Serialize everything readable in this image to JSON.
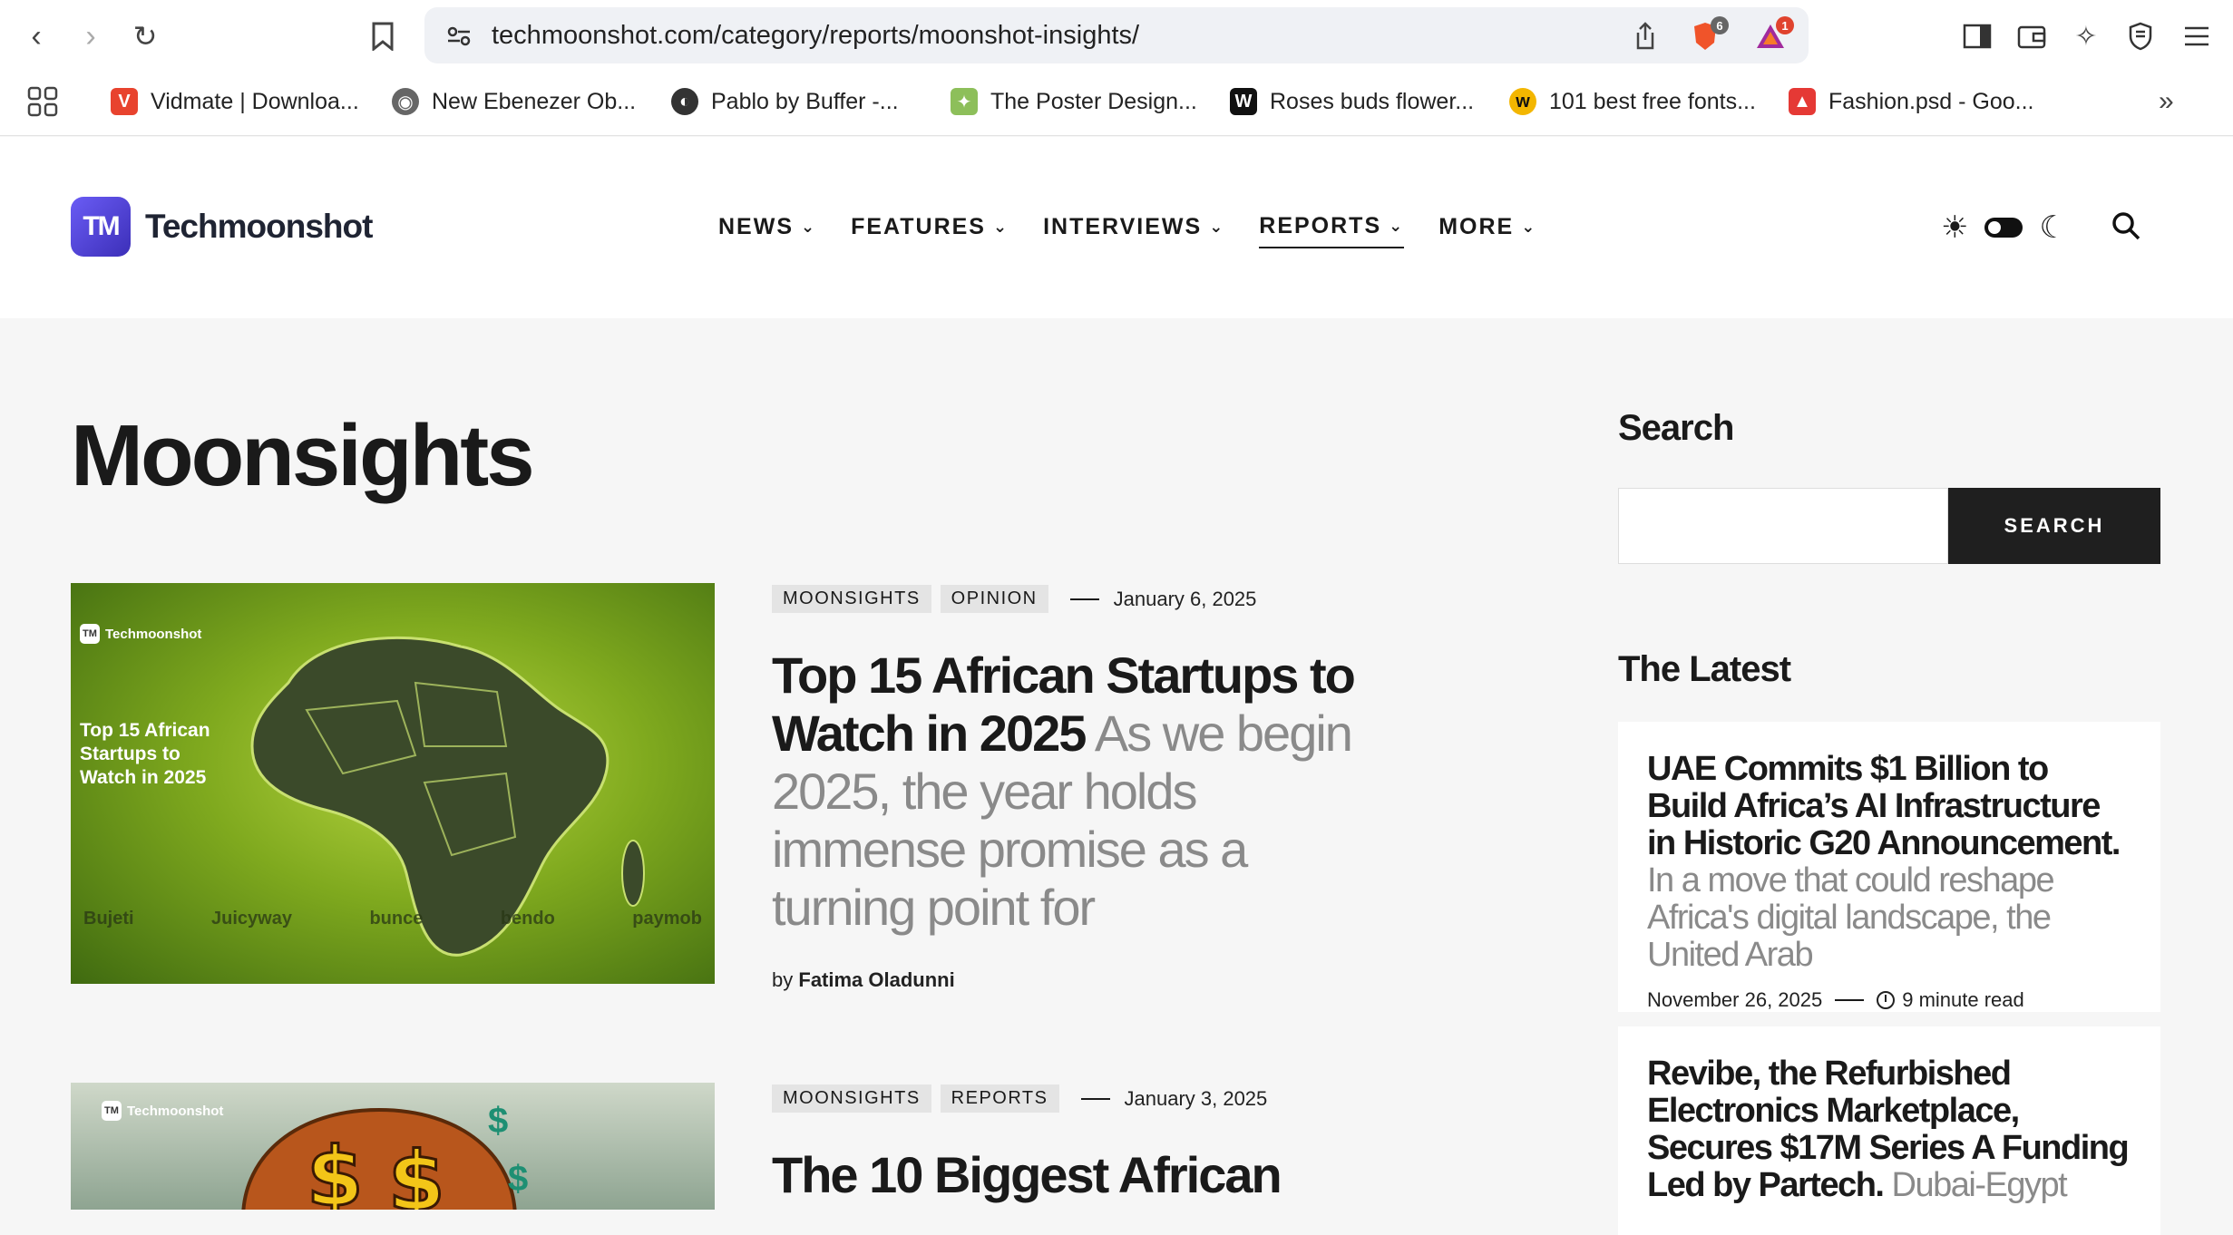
{
  "browser": {
    "url": "techmoonshot.com/category/reports/moonshot-insights/",
    "shield_badge": "6",
    "alert_badge": "1",
    "bookmarks": [
      {
        "label": "Vidmate | Downloa...",
        "icon": "vidmate-icon",
        "color": "#e8432e",
        "glyph": "V"
      },
      {
        "label": "New Ebenezer Ob...",
        "icon": "globe-icon",
        "color": "#555555",
        "glyph": "◉"
      },
      {
        "label": "Pablo by Buffer -...",
        "icon": "pablo-icon",
        "color": "#333333",
        "glyph": "◐"
      },
      {
        "label": "The Poster Design...",
        "icon": "poster-icon",
        "color": "#8dbf5a",
        "glyph": "✦"
      },
      {
        "label": "Roses buds flower...",
        "icon": "w-icon",
        "color": "#111111",
        "glyph": "W"
      },
      {
        "label": "101 best free fonts...",
        "icon": "fonts-icon",
        "color": "#f3b600",
        "glyph": "w"
      },
      {
        "label": "Fashion.psd - Goo...",
        "icon": "image-icon",
        "color": "#e53935",
        "glyph": "▲"
      }
    ]
  },
  "site": {
    "logo_mark": "TM",
    "logo_text": "Techmoonshot",
    "nav": [
      {
        "label": "NEWS",
        "active": false
      },
      {
        "label": "FEATURES",
        "active": false
      },
      {
        "label": "INTERVIEWS",
        "active": false
      },
      {
        "label": "REPORTS",
        "active": true
      },
      {
        "label": "MORE",
        "active": false
      }
    ]
  },
  "main": {
    "page_title": "Moonsights",
    "articles": [
      {
        "tags": [
          "MOONSIGHTS",
          "OPINION"
        ],
        "date": "January 6, 2025",
        "title": "Top 15 African Startups to Watch in 2025",
        "excerpt": "As we begin 2025, the year holds immense promise as a turning point for",
        "by": "by",
        "author": "Fatima Oladunni",
        "thumb_brand": "Techmoonshot",
        "thumb_headline": "Top 15 African Startups to Watch in 2025",
        "thumb_logos": [
          "Bujeti",
          "Juicyway",
          "bunce",
          "bendo",
          "paymob"
        ]
      },
      {
        "tags": [
          "MOONSIGHTS",
          "REPORTS"
        ],
        "date": "January 3, 2025",
        "title": "The 10 Biggest African",
        "thumb_brand": "Techmoonshot"
      }
    ]
  },
  "sidebar": {
    "search_heading": "Search",
    "search_placeholder": "",
    "search_button": "SEARCH",
    "latest_heading": "The Latest",
    "latest": [
      {
        "title": "UAE Commits $1 Billion to Build Africa’s AI Infrastructure in Historic G20 Announcement.",
        "excerpt": "In a move that could reshape Africa's digital landscape, the United Arab",
        "date": "November 26, 2025",
        "read_time": "9 minute read"
      },
      {
        "title": "Revibe, the Refurbished Electronics Marketplace, Secures $17M Series A Funding Led by Partech.",
        "excerpt": "Dubai-Egypt"
      }
    ]
  }
}
